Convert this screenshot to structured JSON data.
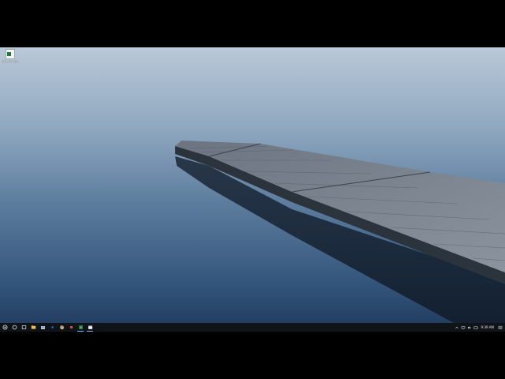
{
  "desktop": {
    "icons": [
      {
        "label": "excel shortcut",
        "icon": "excel-file-icon"
      }
    ],
    "wallpaper": "misty lake with wooden pier"
  },
  "taskbar": {
    "buttons": [
      {
        "icon": "start-icon",
        "active": false
      },
      {
        "icon": "search-icon",
        "active": false
      },
      {
        "icon": "task-view-icon",
        "active": false
      },
      {
        "icon": "file-explorer-icon",
        "active": false
      },
      {
        "icon": "store-icon",
        "active": false
      },
      {
        "icon": "edge-icon",
        "active": false
      },
      {
        "icon": "chrome-icon",
        "active": false
      },
      {
        "icon": "app-icon",
        "active": false
      },
      {
        "icon": "excel-icon",
        "active": true
      },
      {
        "icon": "window-icon",
        "active": true
      }
    ],
    "tray": {
      "icons": [
        "chevron-up-icon",
        "network-icon",
        "volume-icon",
        "keyboard-icon"
      ],
      "clock": "9:39 AM"
    }
  },
  "colors": {
    "sky_top": "#b7c6d8",
    "water_bottom": "#1e3a5c",
    "taskbar": "#101418",
    "active_indicator": "#8ab4e8"
  }
}
